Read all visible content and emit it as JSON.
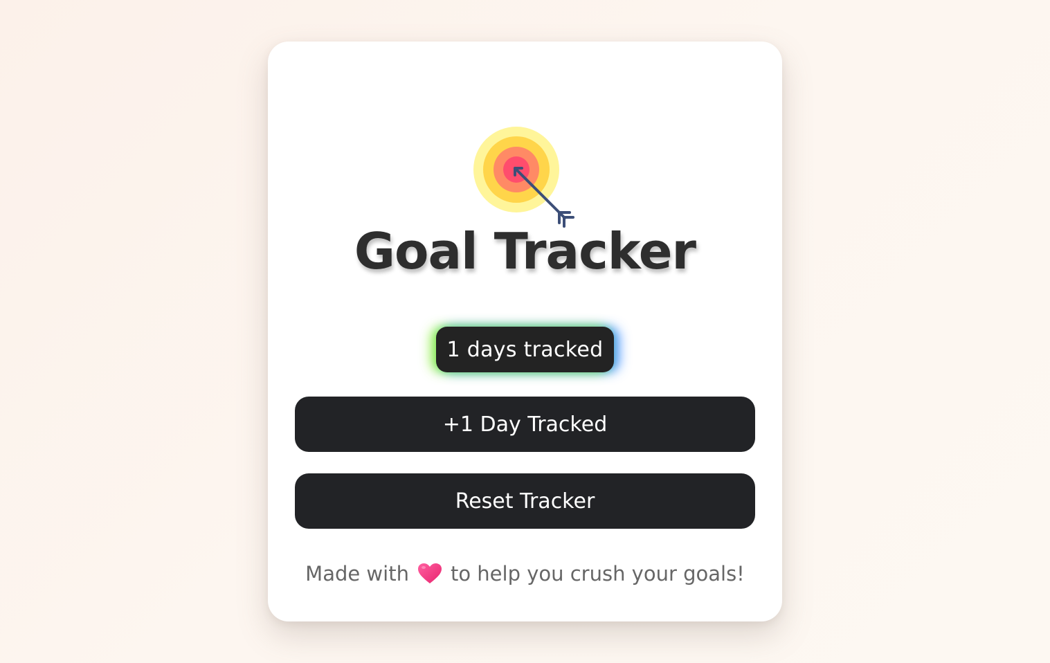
{
  "app": {
    "title": "Goal Tracker"
  },
  "counter": {
    "text": "1 days tracked",
    "days": 1
  },
  "buttons": {
    "add_label": "+1 Day Tracked",
    "reset_label": "Reset Tracker"
  },
  "footer": {
    "prefix": "Made with",
    "suffix": "to help you crush your goals!",
    "icon": "heart-icon"
  },
  "icons": {
    "header": "target-arrow-icon"
  },
  "colors": {
    "background": "#fdf6f0",
    "card": "#ffffff",
    "button": "#222326",
    "title": "#2e2e2e",
    "heart": "#ff3d8b",
    "glow_left": "#8cf03c",
    "glow_right": "#3c8cff"
  }
}
